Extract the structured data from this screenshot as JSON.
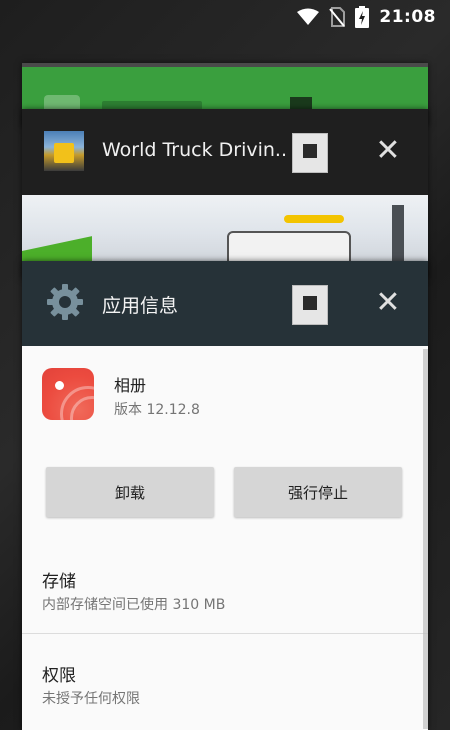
{
  "status_bar": {
    "time": "21:08",
    "icons": [
      "wifi-icon",
      "no-sim-icon",
      "battery-charging-icon"
    ]
  },
  "recents": {
    "background_card": {
      "color": "#3a9f3e"
    },
    "truck_card": {
      "title": "World Truck Drivin..",
      "icon": "truck-app-icon"
    },
    "settings_card": {
      "title": "应用信息",
      "header_color": "#263238",
      "app": {
        "name": "相册",
        "version": "版本 12.12.8",
        "icon_color": "#ec4b3f"
      },
      "buttons": {
        "uninstall": "卸载",
        "force_stop": "强行停止"
      },
      "storage": {
        "title": "存储",
        "summary": "内部存储空间已使用 310 MB"
      },
      "permissions": {
        "title": "权限",
        "summary": "未授予任何权限"
      }
    }
  }
}
